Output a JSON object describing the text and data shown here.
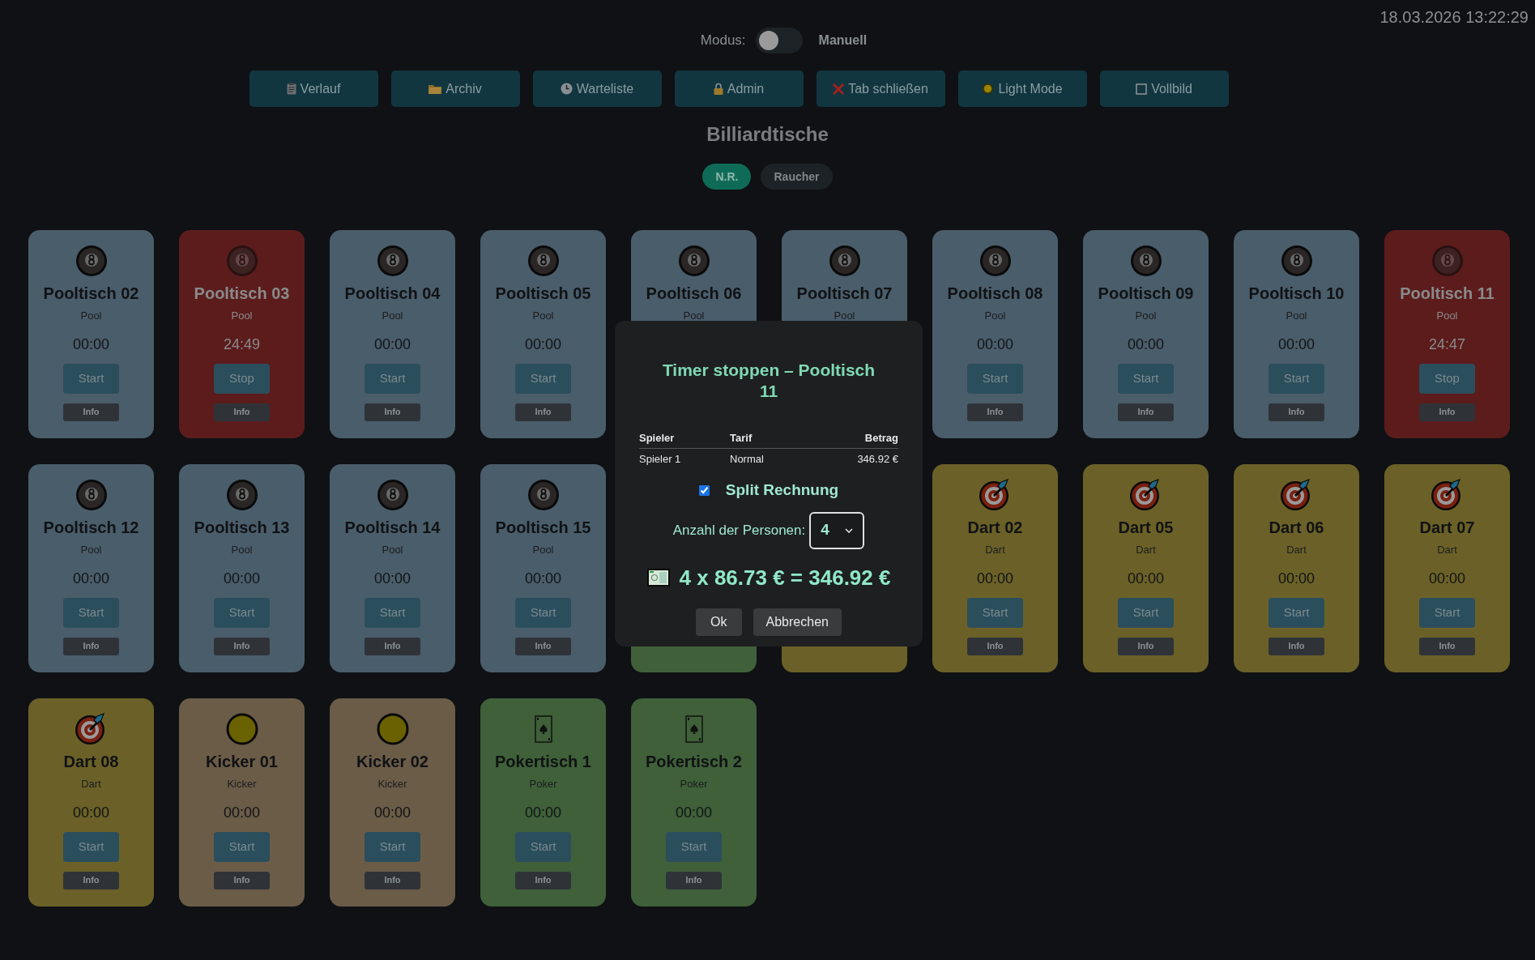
{
  "datetime": "18.03.2026 13:22:29",
  "mode": {
    "label": "Modus:",
    "on": false,
    "value": "Manuell"
  },
  "toolbar": [
    {
      "label": "Verlauf"
    },
    {
      "label": "Archiv"
    },
    {
      "label": "Warteliste"
    },
    {
      "label": "Admin"
    },
    {
      "label": "Tab schließen"
    },
    {
      "label": "Light Mode"
    },
    {
      "label": "Vollbild"
    }
  ],
  "heading": "Billiardtische",
  "filters": [
    {
      "label": "N.R.",
      "selected": true
    },
    {
      "label": "Raucher",
      "selected": false
    }
  ],
  "tables": [
    {
      "kind": "pool",
      "name": "Pooltisch 02",
      "type": "Pool",
      "time": "00:00",
      "running": false,
      "action": "Start",
      "info": "Info"
    },
    {
      "kind": "pool",
      "name": "Pooltisch 03",
      "type": "Pool",
      "time": "24:49",
      "running": true,
      "action": "Stop",
      "info": "Info"
    },
    {
      "kind": "pool",
      "name": "Pooltisch 04",
      "type": "Pool",
      "time": "00:00",
      "running": false,
      "action": "Start",
      "info": "Info"
    },
    {
      "kind": "pool",
      "name": "Pooltisch 05",
      "type": "Pool",
      "time": "00:00",
      "running": false,
      "action": "Start",
      "info": "Info"
    },
    {
      "kind": "pool",
      "name": "Pooltisch 06",
      "type": "Pool",
      "running": false
    },
    {
      "kind": "pool",
      "name": "Pooltisch 07",
      "type": "Pool",
      "running": false
    },
    {
      "kind": "pool",
      "name": "Pooltisch 08",
      "type": "Pool",
      "time": "00:00",
      "running": false,
      "action": "Start",
      "info": "Info"
    },
    {
      "kind": "pool",
      "name": "Pooltisch 09",
      "type": "Pool",
      "time": "00:00",
      "running": false,
      "action": "Start",
      "info": "Info"
    },
    {
      "kind": "pool",
      "name": "Pooltisch 10",
      "type": "Pool",
      "time": "00:00",
      "running": false,
      "action": "Start",
      "info": "Info"
    },
    {
      "kind": "pool",
      "name": "Pooltisch 11",
      "type": "Pool",
      "time": "24:47",
      "running": true,
      "action": "Stop",
      "info": "Info"
    },
    {
      "kind": "pool",
      "name": "Pooltisch 12",
      "type": "Pool",
      "time": "00:00",
      "running": false,
      "action": "Start",
      "info": "Info"
    },
    {
      "kind": "pool",
      "name": "Pooltisch 13",
      "type": "Pool",
      "time": "00:00",
      "running": false,
      "action": "Start",
      "info": "Info"
    },
    {
      "kind": "pool",
      "name": "Pooltisch 14",
      "type": "Pool",
      "time": "00:00",
      "running": false,
      "action": "Start",
      "info": "Info"
    },
    {
      "kind": "pool",
      "name": "Pooltisch 15",
      "type": "Pool",
      "time": "00:00",
      "running": false,
      "action": "Start",
      "info": "Info"
    },
    {
      "kind": "poker",
      "running": false
    },
    {
      "kind": "dart",
      "running": false
    },
    {
      "kind": "dart",
      "name": "Dart 02",
      "type": "Dart",
      "time": "00:00",
      "running": false,
      "action": "Start",
      "info": "Info"
    },
    {
      "kind": "dart",
      "name": "Dart 05",
      "type": "Dart",
      "time": "00:00",
      "running": false,
      "action": "Start",
      "info": "Info"
    },
    {
      "kind": "dart",
      "name": "Dart 06",
      "type": "Dart",
      "time": "00:00",
      "running": false,
      "action": "Start",
      "info": "Info"
    },
    {
      "kind": "dart",
      "name": "Dart 07",
      "type": "Dart",
      "time": "00:00",
      "running": false,
      "action": "Start",
      "info": "Info"
    },
    {
      "kind": "dart",
      "name": "Dart 08",
      "type": "Dart",
      "time": "00:00",
      "running": false,
      "action": "Start",
      "info": "Info"
    },
    {
      "kind": "kicker",
      "name": "Kicker 01",
      "type": "Kicker",
      "time": "00:00",
      "running": false,
      "action": "Start",
      "info": "Info"
    },
    {
      "kind": "kicker",
      "name": "Kicker 02",
      "type": "Kicker",
      "time": "00:00",
      "running": false,
      "action": "Start",
      "info": "Info"
    },
    {
      "kind": "poker",
      "name": "Pokertisch 1",
      "type": "Poker",
      "time": "00:00",
      "running": false,
      "action": "Start",
      "info": "Info"
    },
    {
      "kind": "poker",
      "name": "Pokertisch 2",
      "type": "Poker",
      "time": "00:00",
      "running": false,
      "action": "Start",
      "info": "Info"
    }
  ],
  "dialog": {
    "title": "Timer stoppen – Pooltisch 11",
    "table": {
      "columns": [
        "Spieler",
        "Tarif",
        "Betrag"
      ],
      "rows": [
        [
          "Spieler 1",
          "Normal",
          "346.92 €"
        ]
      ]
    },
    "split": {
      "label": "Split Rechnung",
      "checked": true
    },
    "persons": {
      "label": "Anzahl der Personen:",
      "value": "4"
    },
    "result": "4 x 86.73 € = 346.92 €",
    "buttons": [
      "Ok",
      "Abbrechen"
    ]
  }
}
